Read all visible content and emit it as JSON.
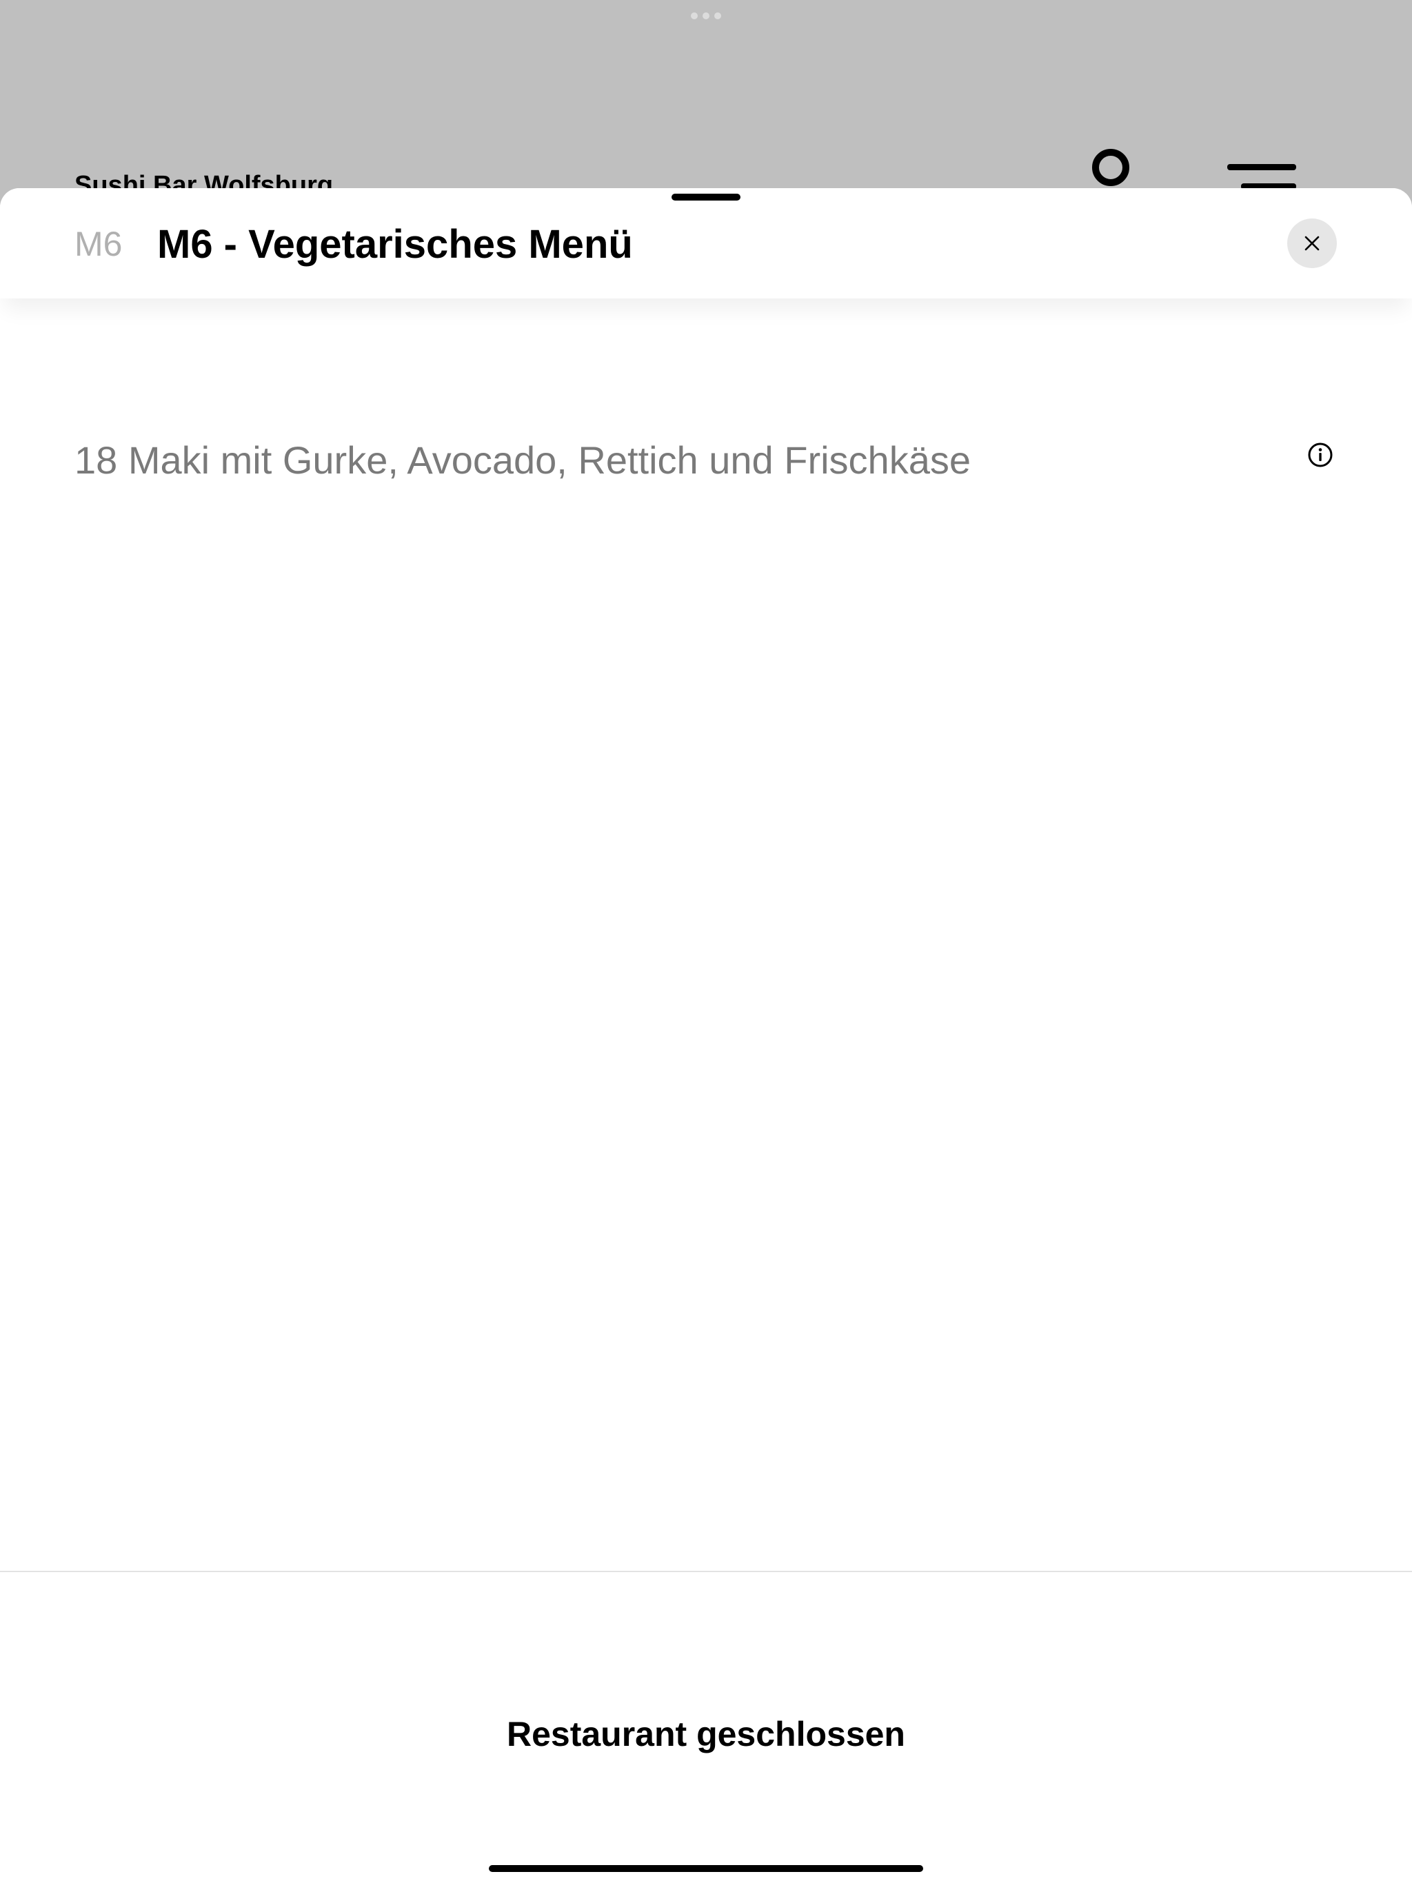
{
  "background": {
    "restaurant_name": "Sushi Bar Wolfsburg",
    "icons": [
      "account-icon",
      "menu-icon"
    ]
  },
  "modal": {
    "item_code": "M6",
    "item_title": "M6 - Vegetarisches Menü",
    "description": "18 Maki mit Gurke, Avocado, Rettich und Frischkäse",
    "close_icon": "close-icon",
    "info_icon": "info-icon"
  },
  "footer": {
    "status": "Restaurant geschlossen"
  },
  "colors": {
    "dimmed_background": "#bfbfbf",
    "sheet": "#ffffff",
    "code_text": "#b0b0b0",
    "description_text": "#7a7a7a",
    "close_button_bg": "#e6e6e6"
  }
}
